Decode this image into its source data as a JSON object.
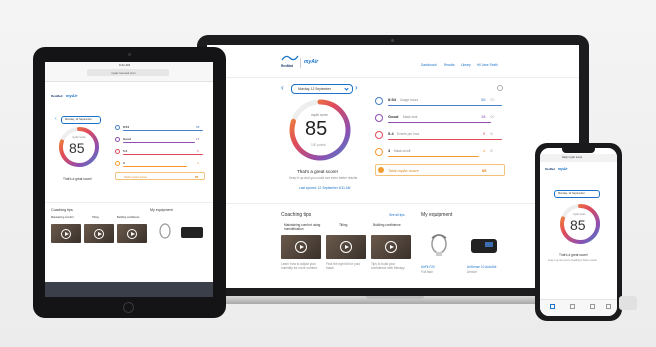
{
  "brand": {
    "maker": "ResMed",
    "app": "myAir",
    "accent": "#1a73c8",
    "score_gradient": [
      "#4a80c7",
      "#8e4fb0",
      "#e04b5a",
      "#f39b2f"
    ]
  },
  "laptop": {
    "nav": [
      "Dashboard",
      "Results",
      "Library",
      "Hi! Jane Smith"
    ],
    "date_picker": "Monday, 12 September",
    "score_label": "myAir score",
    "score_value": "85",
    "score_max": "100 points",
    "message": "That's a great score!",
    "sub_message": "Keep it up and you could see even better results",
    "sync_note": "Last synced: 12 September 8:31 AM",
    "metrics": [
      {
        "label": "Usage hours",
        "value": "8:54",
        "points": "58",
        "max": "/70",
        "color": "#4a80c7",
        "icon": "clock-icon"
      },
      {
        "label": "Mask seal",
        "value": "Good",
        "points": "18",
        "max": "/20",
        "color": "#8e4fb0",
        "icon": "mask-icon"
      },
      {
        "label": "Events per hour",
        "value": "5.4",
        "points": "5",
        "max": "/5",
        "color": "#e04b5a",
        "icon": "events-icon"
      },
      {
        "label": "Mask on/off",
        "value": "3",
        "points": "4",
        "max": "/5",
        "color": "#f39b2f",
        "icon": "mask-on-off-icon"
      }
    ],
    "total_label": "Total myAir score",
    "total_value": "85",
    "coaching_title": "Coaching tips",
    "see_all": "See all tips",
    "tips": [
      {
        "title": "Maintaining comfort using humidification",
        "desc": "Learn how to adjust your humidity for more comfort"
      },
      {
        "title": "Tilting",
        "desc": "Find the right tilt for your mask"
      },
      {
        "title": "Building confidence",
        "desc": "Tips to build your confidence with therapy"
      }
    ],
    "equipment_title": "My equipment",
    "equipment": [
      {
        "name": "AirFit F20",
        "sub": "Full face"
      },
      {
        "name": "AirSense 10 AutoSet",
        "sub": "Device"
      }
    ]
  },
  "tablet": {
    "status_time": "9:41 AM",
    "url": "myair.resmed.com",
    "date_picker": "Monday, 12 September",
    "score_label": "myAir score",
    "score_value": "85",
    "message": "That's a great score!",
    "metrics": [
      {
        "label": "Usage hours",
        "value": "8:54",
        "points": "58",
        "color": "#4a80c7"
      },
      {
        "label": "Mask seal",
        "value": "Good",
        "points": "17",
        "color": "#8e4fb0"
      },
      {
        "label": "Events per hour",
        "value": "5.4",
        "points": "5",
        "color": "#e04b5a"
      },
      {
        "label": "Mask on/off",
        "value": "3",
        "points": "4",
        "color": "#f39b2f"
      }
    ],
    "total_label": "Total myAir score",
    "total_value": "85",
    "coaching_title": "Coaching tips",
    "tips": [
      "Maintaining comfort",
      "Tilting",
      "Building confidence"
    ],
    "equipment_title": "My equipment"
  },
  "phone": {
    "header": "Daily myAir score",
    "date_picker": "Monday, 12 September",
    "score_label": "myAir score",
    "score_value": "85",
    "message": "That's a great score!",
    "sub_message": "Keep it up and you're heading to better results"
  }
}
